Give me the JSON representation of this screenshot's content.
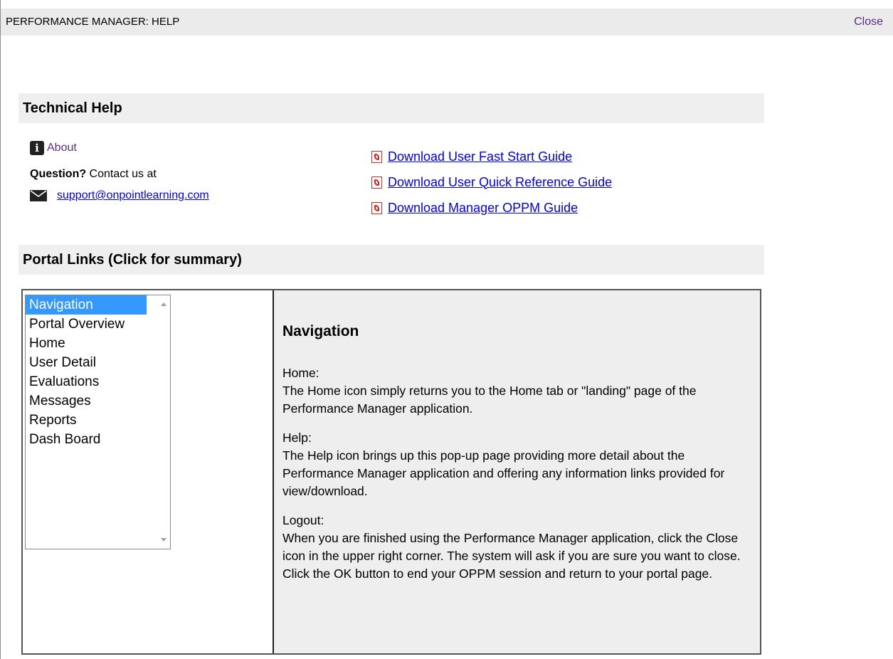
{
  "window": {
    "title": "PERFORMANCE MANAGER: HELP",
    "close_label": "Close"
  },
  "technical_help": {
    "heading": "Technical Help",
    "about_label": "About",
    "question_bold": "Question?",
    "question_text": " Contact us at",
    "email": "support@onpointlearning.com",
    "downloads": [
      {
        "label": "Download User Fast Start Guide",
        "icon": "pdf-icon"
      },
      {
        "label": "Download User Quick Reference Guide",
        "icon": "pdf-icon"
      },
      {
        "label": "Download Manager OPPM Guide",
        "icon": "pdf-icon"
      }
    ]
  },
  "portal_links": {
    "heading": "Portal Links (Click for summary)",
    "items": [
      {
        "label": "Navigation",
        "selected": true
      },
      {
        "label": "Portal Overview",
        "selected": false
      },
      {
        "label": "Home",
        "selected": false
      },
      {
        "label": "User Detail",
        "selected": false
      },
      {
        "label": "Evaluations",
        "selected": false
      },
      {
        "label": "Messages",
        "selected": false
      },
      {
        "label": "Reports",
        "selected": false
      },
      {
        "label": "Dash Board",
        "selected": false
      }
    ],
    "detail": {
      "title": "Navigation",
      "paragraphs": [
        "Home:\nThe Home icon simply returns you to the Home tab or \"landing\" page of the Performance Manager application.",
        "Help:\nThe Help icon brings up this pop-up page providing more detail about the Performance Manager application and offering any information links provided for view/download.",
        "Logout:\nWhen you are finished using the Performance Manager application, click the Close icon in the upper right corner. The system will ask if you are sure you want to close. Click the OK button to end your OPPM session and return to your portal page."
      ]
    }
  },
  "colors": {
    "link": "#0000ee",
    "visited_link": "#5a2d82",
    "selection": "#3399ff",
    "header_bg": "#efefef"
  }
}
